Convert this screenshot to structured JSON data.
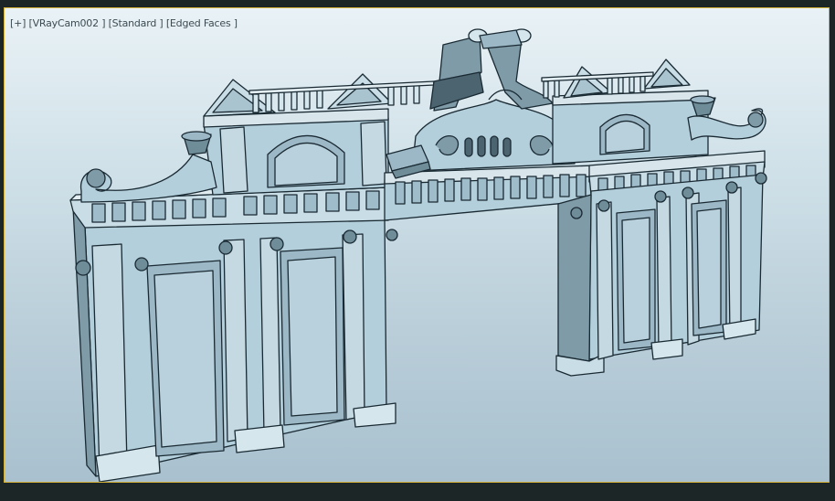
{
  "viewport": {
    "labels": [
      "[+]",
      "[VRayCam002 ]",
      "[Standard ]",
      "[Edged Faces ]"
    ],
    "active_border_color": "#d4b23a",
    "background_top": "#e9f2f6",
    "background_bottom": "#a9c1cf"
  },
  "model": {
    "fill_color": "#b4cfdc",
    "shade_color": "#7f9ba8",
    "dark_color": "#4c6470",
    "edge_color": "#1a2a33"
  }
}
